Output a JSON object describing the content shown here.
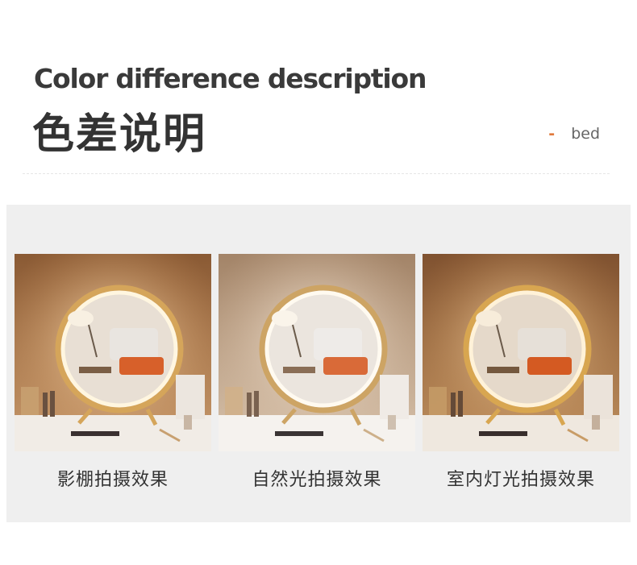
{
  "header": {
    "title_en": "Color difference description",
    "title_cn": "色差说明",
    "tag_dash": "-",
    "tag_text": "bed"
  },
  "cards": [
    {
      "caption": "影棚拍摄效果",
      "tone": "studio"
    },
    {
      "caption": "自然光拍摄效果",
      "tone": "natural"
    },
    {
      "caption": "室内灯光拍摄效果",
      "tone": "indoor"
    }
  ],
  "colors": {
    "accent": "#e07a3c",
    "panel_bg": "#efefef",
    "text": "#333333"
  }
}
